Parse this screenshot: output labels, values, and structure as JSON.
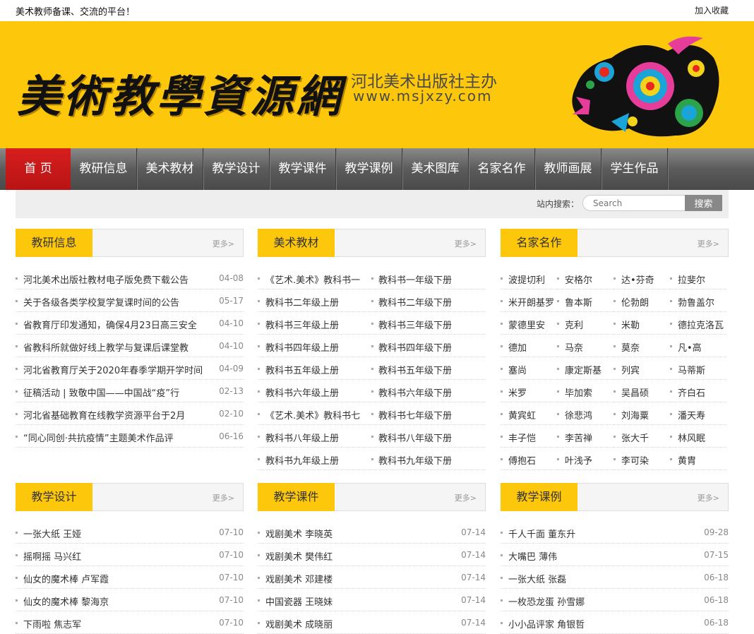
{
  "topbar": {
    "tagline": "美术教师备课、交流的平台！",
    "favorite": "加入收藏"
  },
  "banner": {
    "logo": "美術教學資源網",
    "publisher": "河北美术出版社主办",
    "url": "www.msjxzy.com",
    "bg_color": "#fdc70c"
  },
  "nav": [
    "首 页",
    "教研信息",
    "美术教材",
    "教学设计",
    "教学课件",
    "教学课例",
    "美术图库",
    "名家名作",
    "教师画展",
    "学生作品"
  ],
  "search": {
    "label": "站内搜索：",
    "placeholder": "Search",
    "button": "搜索"
  },
  "more_label": "更多>",
  "panels": {
    "jiaoyan": {
      "title": "教研信息",
      "items": [
        {
          "text": "河北美术出版社教材电子版免费下载公告",
          "date": "04-08"
        },
        {
          "text": "关于各级各类学校复学复课时间的公告",
          "date": "05-17"
        },
        {
          "text": "省教育厅印发通知，确保4月23日高三安全",
          "date": "04-10"
        },
        {
          "text": "省教科所就做好线上教学与复课后课堂教",
          "date": "04-10"
        },
        {
          "text": "河北省教育厅关于2020年春季学期开学时间",
          "date": "04-09"
        },
        {
          "text": "征稿活动 | 致敬中国——中国战“疫”行",
          "date": "02-13"
        },
        {
          "text": "河北省基础教育在线教学资源平台于2月",
          "date": "02-10"
        },
        {
          "text": "“同心同创·共抗疫情”主题美术作品评",
          "date": "06-16"
        }
      ]
    },
    "jiaocai": {
      "title": "美术教材",
      "items": [
        [
          "《艺术.美术》教科书一",
          "教科书一年级下册"
        ],
        [
          "教科书二年级上册",
          "教科书二年级下册"
        ],
        [
          "教科书三年级上册",
          "教科书三年级下册"
        ],
        [
          "教科书四年级上册",
          "教科书四年级下册"
        ],
        [
          "教科书五年级上册",
          "教科书五年级下册"
        ],
        [
          "教科书六年级上册",
          "教科书六年级下册"
        ],
        [
          "《艺术.美术》教科书七",
          "教科书七年级下册"
        ],
        [
          "教科书八年级上册",
          "教科书八年级下册"
        ],
        [
          "教科书九年级上册",
          "教科书九年级下册"
        ]
      ]
    },
    "mingjia": {
      "title": "名家名作",
      "items": [
        "波提切利",
        "安格尔",
        "达•芬奇",
        "拉斐尔",
        "米开朗基罗",
        "鲁本斯",
        "伦勃朗",
        "勃鲁盖尔",
        "蒙德里安",
        "克利",
        "米勒",
        "德拉克洛瓦",
        "德加",
        "马奈",
        "莫奈",
        "凡•高",
        "塞尚",
        "康定斯基",
        "列宾",
        "马蒂斯",
        "米罗",
        "毕加索",
        "吴昌硕",
        "齐白石",
        "黄宾虹",
        "徐悲鸿",
        "刘海粟",
        "潘天寿",
        "丰子恺",
        "李苦禅",
        "张大千",
        "林风眠",
        "傅抱石",
        "叶浅予",
        "李可染",
        "黄胄"
      ]
    },
    "sheji": {
      "title": "教学设计",
      "items": [
        {
          "text": "一张大纸 王娅",
          "date": "07-10"
        },
        {
          "text": "摇啊摇 马兴红",
          "date": "07-10"
        },
        {
          "text": "仙女的魔术棒 卢军霞",
          "date": "07-10"
        },
        {
          "text": "仙女的魔术棒 黎海京",
          "date": "07-10"
        },
        {
          "text": "下雨啦 焦志军",
          "date": "07-10"
        }
      ]
    },
    "kejian": {
      "title": "教学课件",
      "items": [
        {
          "text": "戏剧美术 李晓英",
          "date": "07-14"
        },
        {
          "text": "戏剧美术 樊伟红",
          "date": "07-14"
        },
        {
          "text": "戏剧美术 邓建楼",
          "date": "07-14"
        },
        {
          "text": "中国瓷器 王晓妹",
          "date": "07-14"
        },
        {
          "text": "戏剧美术 成晓丽",
          "date": "07-14"
        }
      ]
    },
    "keli": {
      "title": "教学课例",
      "items": [
        {
          "text": "千人千面 董东升",
          "date": "09-28"
        },
        {
          "text": "大嘴巴 薄伟",
          "date": "07-15"
        },
        {
          "text": "一张大纸 张磊",
          "date": "06-18"
        },
        {
          "text": "一枚恐龙蛋 孙雪娜",
          "date": "06-18"
        },
        {
          "text": "小小品评家 角银哲",
          "date": "06-18"
        }
      ]
    }
  }
}
